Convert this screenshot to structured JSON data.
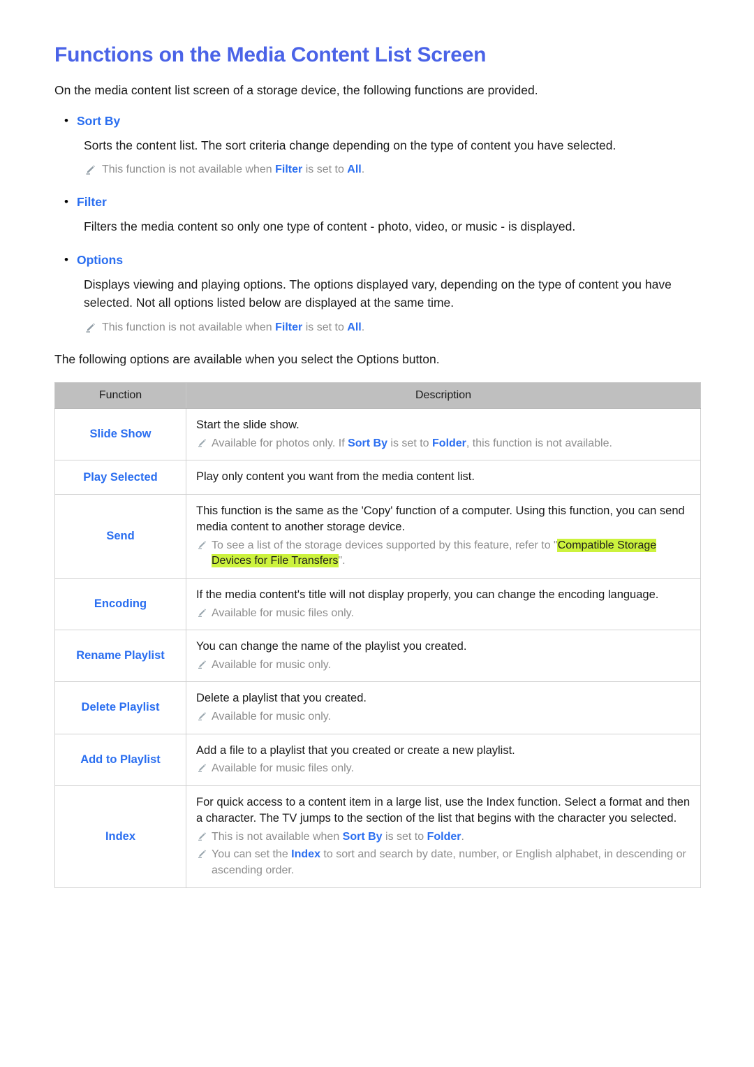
{
  "title": "Functions on the Media Content List Screen",
  "intro": "On the media content list screen of a storage device, the following functions are provided.",
  "sections": [
    {
      "bullet": "Sort By",
      "body": "Sorts the content list. The sort criteria change depending on the type of content you have selected.",
      "note": {
        "pre": "This function is not available when ",
        "kw1": "Filter",
        "mid": " is set to ",
        "kw2": "All",
        "post": "."
      }
    },
    {
      "bullet": "Filter",
      "body": "Filters the media content so only one type of content - photo, video, or music - is displayed.",
      "note": null
    },
    {
      "bullet": "Options",
      "body": "Displays viewing and playing options. The options displayed vary, depending on the type of content you have selected. Not all options listed below are displayed at the same time.",
      "note": {
        "pre": "This function is not available when ",
        "kw1": "Filter",
        "mid": " is set to ",
        "kw2": "All",
        "post": "."
      }
    }
  ],
  "lead_in": "The following options are available when you select the Options button.",
  "table": {
    "headers": {
      "function": "Function",
      "description": "Description"
    },
    "rows": [
      {
        "function": "Slide Show",
        "lines": [
          "Start the slide show."
        ],
        "notes": [
          {
            "segments": [
              {
                "t": "Available for photos only. If ",
                "s": "plain"
              },
              {
                "t": "Sort By",
                "s": "kw"
              },
              {
                "t": " is set to ",
                "s": "plain"
              },
              {
                "t": "Folder",
                "s": "kw"
              },
              {
                "t": ", this function is not available.",
                "s": "plain"
              }
            ]
          }
        ]
      },
      {
        "function": "Play Selected",
        "lines": [
          "Play only content you want from the media content list."
        ],
        "notes": []
      },
      {
        "function": "Send",
        "lines": [
          "This function is the same as the 'Copy' function of a computer. Using this function, you can send media content to another storage device."
        ],
        "notes": [
          {
            "segments": [
              {
                "t": "To see a list of the storage devices supported by this feature, refer to \"",
                "s": "plain"
              },
              {
                "t": "Compatible Storage Devices for File Transfers",
                "s": "hl"
              },
              {
                "t": "\".",
                "s": "plain"
              }
            ]
          }
        ]
      },
      {
        "function": "Encoding",
        "lines": [
          "If the media content's title will not display properly, you can change the encoding language."
        ],
        "notes": [
          {
            "segments": [
              {
                "t": "Available for music files only.",
                "s": "plain"
              }
            ]
          }
        ]
      },
      {
        "function": "Rename Playlist",
        "lines": [
          "You can change the name of the playlist you created."
        ],
        "notes": [
          {
            "segments": [
              {
                "t": "Available for music only.",
                "s": "plain"
              }
            ]
          }
        ]
      },
      {
        "function": "Delete Playlist",
        "lines": [
          "Delete a playlist that you created."
        ],
        "notes": [
          {
            "segments": [
              {
                "t": "Available for music only.",
                "s": "plain"
              }
            ]
          }
        ]
      },
      {
        "function": "Add to Playlist",
        "lines": [
          "Add a file to a playlist that you created or create a new playlist."
        ],
        "notes": [
          {
            "segments": [
              {
                "t": "Available for music files only.",
                "s": "plain"
              }
            ]
          }
        ]
      },
      {
        "function": "Index",
        "lines": [
          "For quick access to a content item in a large list, use the Index function. Select a format and then a character. The TV jumps to the section of the list that begins with the character you selected."
        ],
        "notes": [
          {
            "segments": [
              {
                "t": "This is not available when ",
                "s": "plain"
              },
              {
                "t": "Sort By",
                "s": "kw"
              },
              {
                "t": " is set to ",
                "s": "plain"
              },
              {
                "t": "Folder",
                "s": "kw"
              },
              {
                "t": ".",
                "s": "plain"
              }
            ]
          },
          {
            "segments": [
              {
                "t": "You can set the ",
                "s": "plain"
              },
              {
                "t": "Index",
                "s": "kw"
              },
              {
                "t": " to sort and search by date, number, or English alphabet, in descending or ascending order.",
                "s": "plain"
              }
            ]
          }
        ]
      }
    ]
  },
  "colors": {
    "title_blue": "#4a63e7",
    "link_blue": "#2a6ef0",
    "note_grey": "#8d8d8d",
    "highlight": "#ccf23d",
    "header_grey": "#bfbfbf"
  },
  "icons": {
    "bullet": "•",
    "note": "pencil-icon"
  }
}
